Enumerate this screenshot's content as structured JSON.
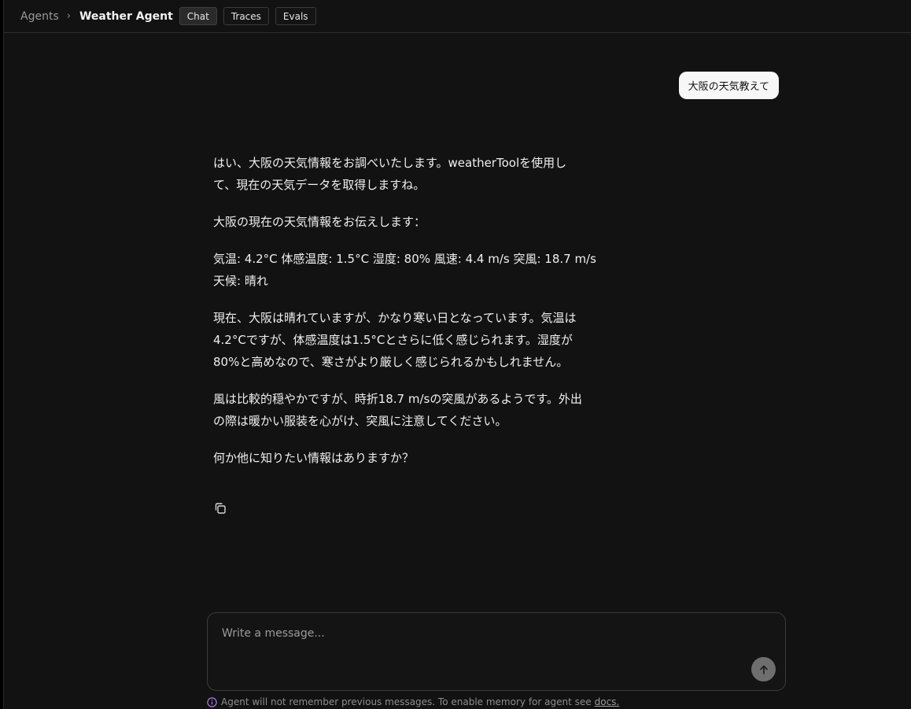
{
  "breadcrumb": {
    "root": "Agents",
    "separator": "›",
    "current": "Weather Agent"
  },
  "tabs": [
    {
      "label": "Chat",
      "active": true
    },
    {
      "label": "Traces",
      "active": false
    },
    {
      "label": "Evals",
      "active": false
    }
  ],
  "messages": {
    "user": "大阪の天気教えて",
    "assistant": {
      "p1_l1": "はい、大阪の天気情報をお調べいたします。weatherToolを使用し",
      "p1_l2": "て、現在の天気データを取得しますね。",
      "p2": "大阪の現在の天気情報をお伝えします：",
      "p3_l1": "気温: 4.2°C 体感温度: 1.5°C 湿度: 80% 風速: 4.4 m/s 突風: 18.7 m/s",
      "p3_l2": "天候: 晴れ",
      "p4_l1": "現在、大阪は晴れていますが、かなり寒い日となっています。気温は",
      "p4_l2": "4.2°Cですが、体感温度は1.5°Cとさらに低く感じられます。湿度が",
      "p4_l3": "80%と高めなので、寒さがより厳しく感じられるかもしれません。",
      "p5_l1": "風は比較的穏やかですが、時折18.7 m/sの突風があるようです。外出",
      "p5_l2": "の際は暖かい服装を心がけ、突風に注意してください。",
      "p6": "何か他に知りたい情報はありますか？"
    }
  },
  "composer": {
    "placeholder": "Write a message...",
    "value": ""
  },
  "notice": {
    "text": "Agent will not remember previous messages. To enable memory for agent see",
    "link": "docs."
  },
  "icons": {
    "copy": "copy-icon",
    "send": "arrow-up-icon",
    "info": "info-icon"
  },
  "colors": {
    "background": "#121212",
    "user_bubble": "#f7f7f7",
    "send_button": "#6e6e6e",
    "info_icon": "#b07cf0"
  }
}
